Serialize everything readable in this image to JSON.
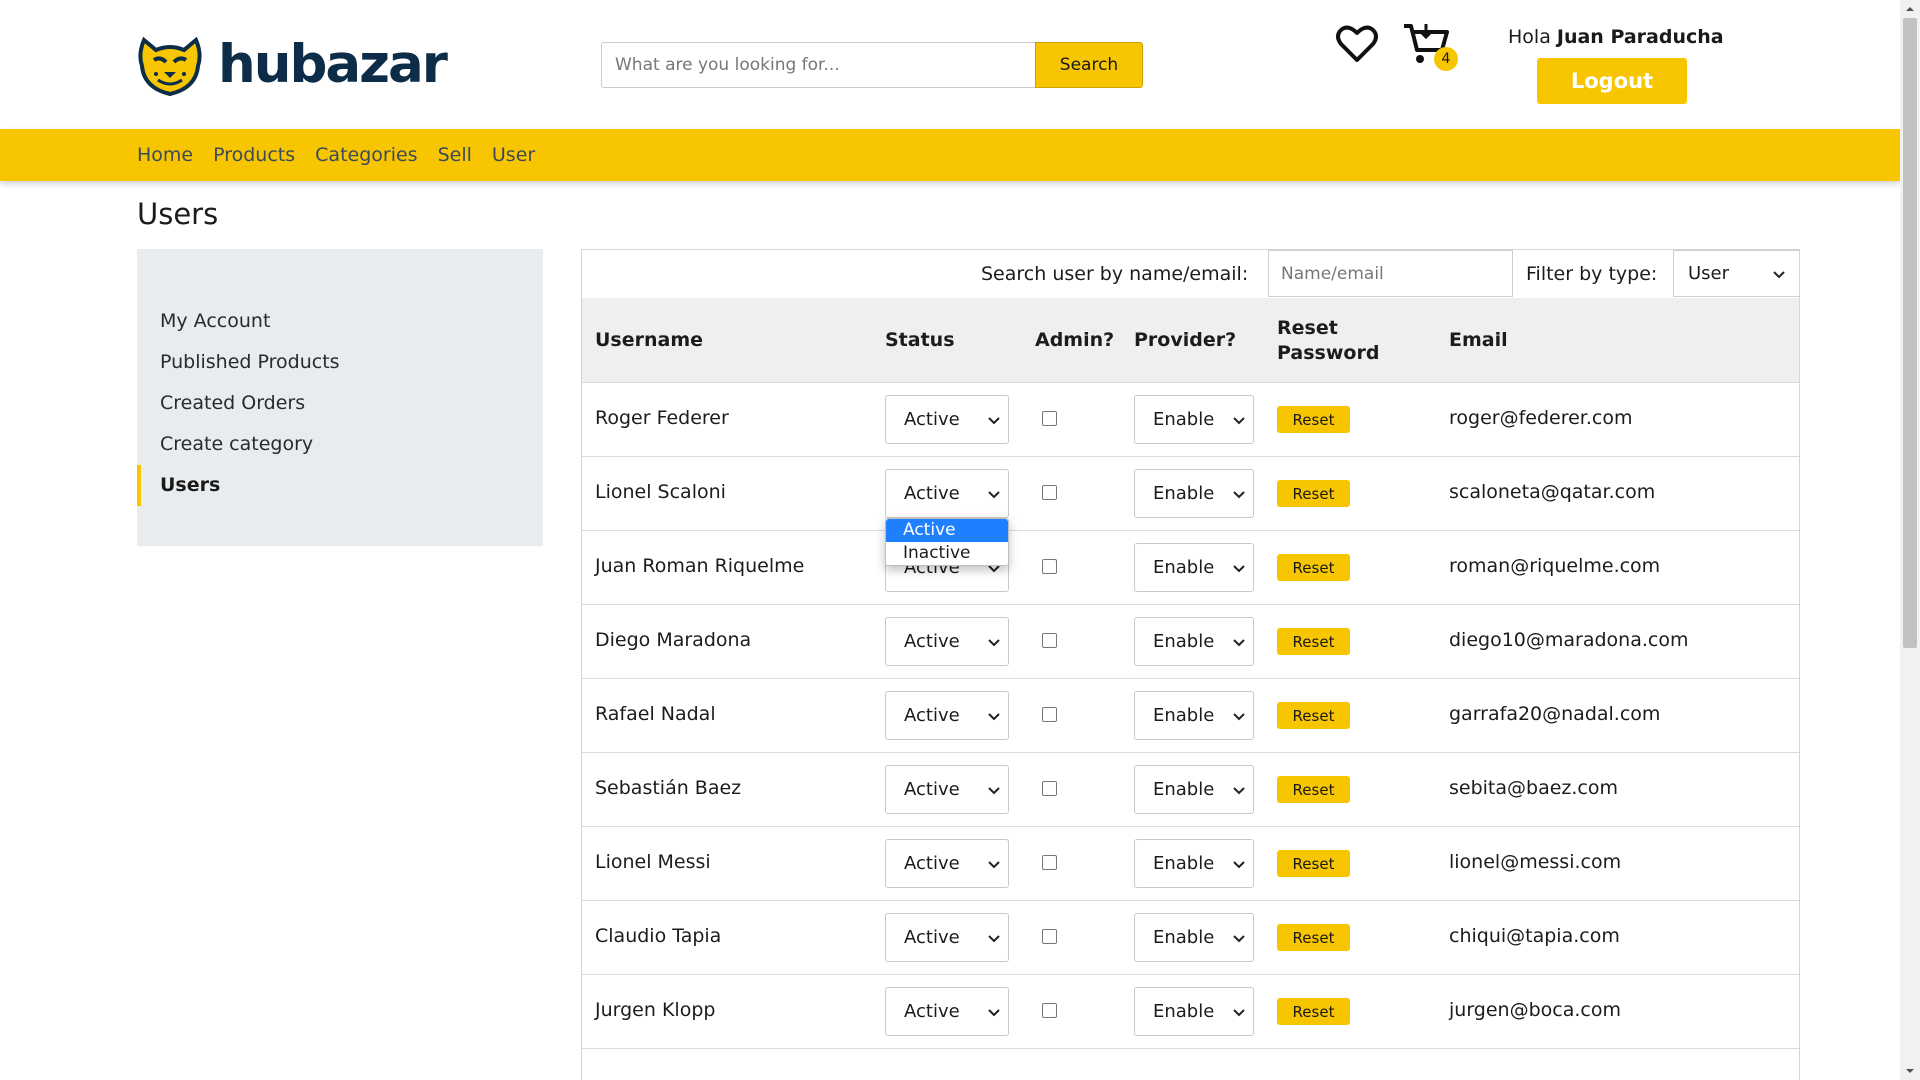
{
  "brand": {
    "name": "hubazar",
    "accent": "#f7c600",
    "navy": "#0c2c48"
  },
  "header": {
    "search_placeholder": "What are you looking for...",
    "search_button": "Search",
    "cart_count": "4",
    "greeting_prefix": "Hola",
    "user_name": "Juan Paraducha",
    "logout_label": "Logout"
  },
  "nav": [
    "Home",
    "Products",
    "Categories",
    "Sell",
    "User"
  ],
  "page_title": "Users",
  "sidebar": {
    "items": [
      {
        "label": "My Account"
      },
      {
        "label": "Published Products"
      },
      {
        "label": "Created Orders"
      },
      {
        "label": "Create category"
      },
      {
        "label": "Users",
        "active": true
      }
    ]
  },
  "filters": {
    "search_label": "Search user by name/email:",
    "search_placeholder": "Name/email",
    "type_label": "Filter by type:",
    "type_value": "User"
  },
  "table": {
    "headers": {
      "username": "Username",
      "status": "Status",
      "admin": "Admin?",
      "provider": "Provider?",
      "reset_line1": "Reset",
      "reset_line2": "Password",
      "email": "Email"
    },
    "reset_label": "Reset",
    "rows": [
      {
        "username": "Roger Federer",
        "status": "Active",
        "admin": false,
        "provider": "Enable",
        "email": "roger@federer.com"
      },
      {
        "username": "Lionel Scaloni",
        "status": "Active",
        "admin": false,
        "provider": "Enable",
        "email": "scaloneta@qatar.com"
      },
      {
        "username": "Juan Roman Riquelme",
        "status": "Active",
        "admin": false,
        "provider": "Enable",
        "email": "roman@riquelme.com"
      },
      {
        "username": "Diego Maradona",
        "status": "Active",
        "admin": false,
        "provider": "Enable",
        "email": "diego10@maradona.com"
      },
      {
        "username": "Rafael Nadal",
        "status": "Active",
        "admin": false,
        "provider": "Enable",
        "email": "garrafa20@nadal.com"
      },
      {
        "username": "Sebastián Baez",
        "status": "Active",
        "admin": false,
        "provider": "Enable",
        "email": "sebita@baez.com"
      },
      {
        "username": "Lionel Messi",
        "status": "Active",
        "admin": false,
        "provider": "Enable",
        "email": "lionel@messi.com"
      },
      {
        "username": "Claudio Tapia",
        "status": "Active",
        "admin": false,
        "provider": "Enable",
        "email": "chiqui@tapia.com"
      },
      {
        "username": "Jurgen Klopp",
        "status": "Active",
        "admin": false,
        "provider": "Enable",
        "email": "jurgen@boca.com"
      }
    ]
  },
  "status_dropdown": {
    "options": [
      "Active",
      "Inactive"
    ],
    "highlighted": "Active"
  }
}
